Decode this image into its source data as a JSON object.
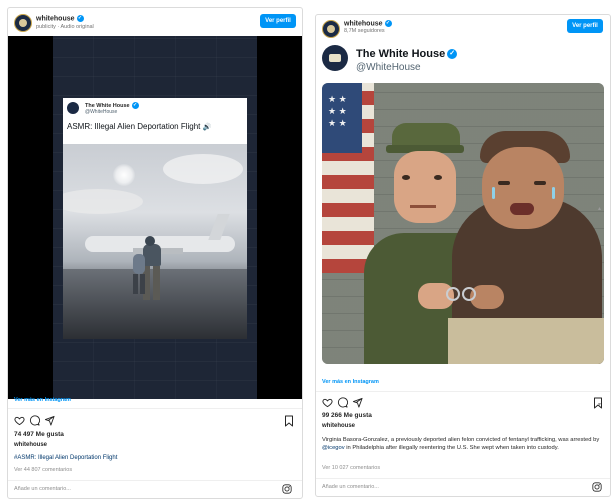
{
  "post_left": {
    "username": "whitehouse",
    "subtitle": "publicity · Audio original",
    "view_profile": "Ver perfil",
    "video_header_name": "The White House",
    "video_header_handle": "@WhiteHouse",
    "video_title": "ASMR: Illegal Alien Deportation Flight",
    "view_more": "Ver más en Instagram",
    "likes": "74 497 Me gusta",
    "caption_user": "whitehouse",
    "caption_text": "#ASMR: Illegal Alien Deportation Flight",
    "comments": "Ver 44 807 comentarios",
    "add_comment": "Añade un comentario..."
  },
  "post_right": {
    "username": "whitehouse",
    "subtitle": "8,7M seguidores",
    "view_profile": "Ver perfil",
    "tweet_name": "The White House",
    "tweet_handle": "@WhiteHouse",
    "view_more": "Ver más en Instagram",
    "likes": "99 266 Me gusta",
    "caption_user": "whitehouse",
    "caption_text_1": "Virginia Basora-Gonzalez, a previously deported alien felon convicted of fentanyl trafficking, was arrested by ",
    "caption_mention": "@icegov",
    "caption_text_2": " in Philadelphia after illegally reentering the U.S. She wept when taken into custody.",
    "comments": "Ver 10 027 comentarios",
    "add_comment": "Añade un comentario..."
  },
  "colors": {
    "accent": "#0095f6",
    "text": "#262626",
    "muted": "#8e8e8e",
    "border": "#dbdbdb"
  },
  "icons": [
    "heart-icon",
    "comment-icon",
    "share-icon",
    "bookmark-icon",
    "instagram-icon",
    "verified-icon",
    "speaker-icon"
  ]
}
